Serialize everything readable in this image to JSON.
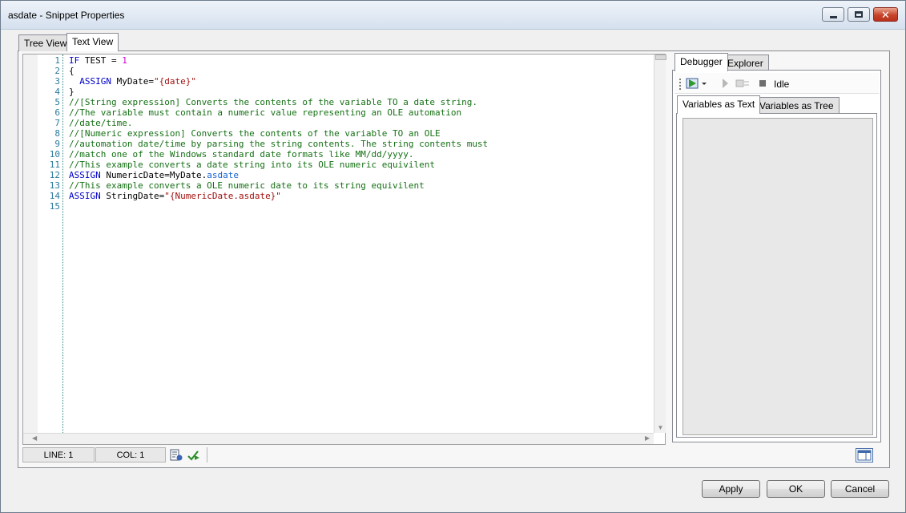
{
  "window": {
    "title": "asdate - Snippet Properties"
  },
  "tabs": [
    {
      "label": "Tree View"
    },
    {
      "label": "Text View"
    }
  ],
  "editor": {
    "line_numbers": [
      "1",
      "2",
      "3",
      "4",
      "5",
      "6",
      "7",
      "8",
      "9",
      "10",
      "11",
      "12",
      "13",
      "14",
      "15"
    ],
    "code": {
      "l1_kw": "IF",
      "l1_text": " TEST = ",
      "l1_num": "1",
      "l2": "{",
      "l3_kw": "  ASSIGN",
      "l3_text": " MyDate=",
      "l3_str": "\"{date}\"",
      "l4": "}",
      "l5": "//[String expression] Converts the contents of the variable TO a date string.",
      "l6": "//The variable must contain a numeric value representing an OLE automation",
      "l7": "//date/time.",
      "l8": "//[Numeric expression] Converts the contents of the variable TO an OLE",
      "l9": "//automation date/time by parsing the string contents. The string contents must",
      "l10": "//match one of the Windows standard date formats like MM/dd/yyyy.",
      "l11": "//This example converts a date string into its OLE numeric equivilent",
      "l12_kw": "ASSIGN",
      "l12_text": " NumericDate=MyDate.",
      "l12_prop": "asdate",
      "l13": "//This example converts a OLE numeric date to its string equivilent",
      "l14_kw": "ASSIGN",
      "l14_text": " StringDate=",
      "l14_str": "\"{NumericDate.asdate}\""
    }
  },
  "status": {
    "line": "LINE: 1",
    "col": "COL: 1"
  },
  "debugger": {
    "tabs": [
      {
        "label": "Debugger"
      },
      {
        "label": "Explorer"
      }
    ],
    "state": "Idle",
    "var_tabs": [
      {
        "label": "Variables as Text"
      },
      {
        "label": "Variables as Tree"
      }
    ]
  },
  "buttons": {
    "apply": "Apply",
    "ok": "OK",
    "cancel": "Cancel"
  },
  "colors": {
    "keyword": "#0000c8",
    "number": "#d000d0",
    "string": "#a11010",
    "comment": "#157015",
    "property": "#1a64d4"
  }
}
